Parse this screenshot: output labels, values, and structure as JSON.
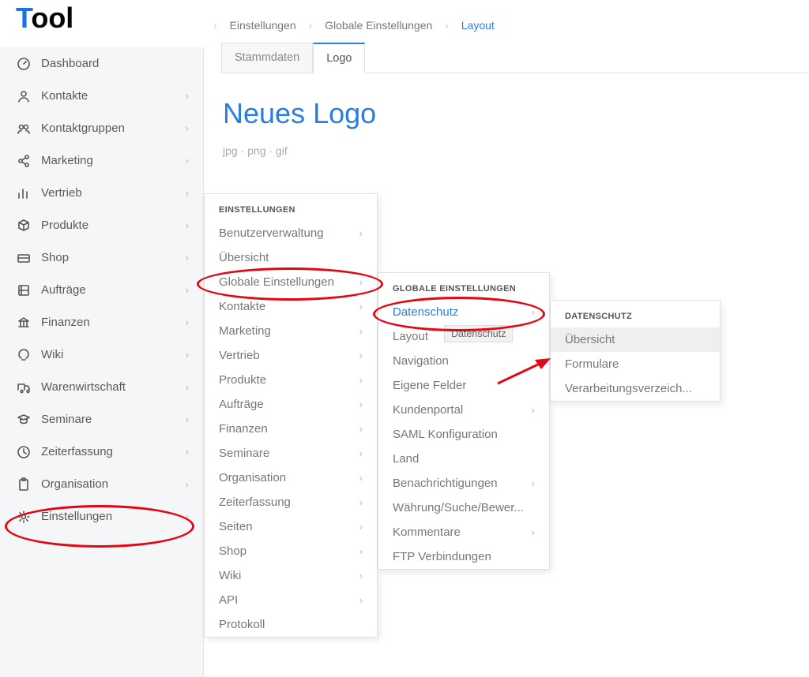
{
  "logo": {
    "t": "T",
    "rest": "ool"
  },
  "sidebar": {
    "items": [
      {
        "label": "Dashboard",
        "chev": false,
        "icon": "gauge"
      },
      {
        "label": "Kontakte",
        "chev": true,
        "icon": "person"
      },
      {
        "label": "Kontaktgruppen",
        "chev": true,
        "icon": "group"
      },
      {
        "label": "Marketing",
        "chev": true,
        "icon": "share"
      },
      {
        "label": "Vertrieb",
        "chev": true,
        "icon": "bars"
      },
      {
        "label": "Produkte",
        "chev": true,
        "icon": "box"
      },
      {
        "label": "Shop",
        "chev": true,
        "icon": "card"
      },
      {
        "label": "Aufträge",
        "chev": true,
        "icon": "order"
      },
      {
        "label": "Finanzen",
        "chev": true,
        "icon": "bank"
      },
      {
        "label": "Wiki",
        "chev": true,
        "icon": "bulb"
      },
      {
        "label": "Warenwirtschaft",
        "chev": true,
        "icon": "truck"
      },
      {
        "label": "Seminare",
        "chev": true,
        "icon": "grad"
      },
      {
        "label": "Zeiterfassung",
        "chev": true,
        "icon": "clock"
      },
      {
        "label": "Organisation",
        "chev": true,
        "icon": "clip"
      },
      {
        "label": "Einstellungen",
        "chev": true,
        "icon": "gear"
      }
    ]
  },
  "breadcrumb": {
    "a": "Einstellungen",
    "b": "Globale Einstellungen",
    "c": "Layout"
  },
  "tabs": {
    "a": "Stammdaten",
    "b": "Logo"
  },
  "page": {
    "title": "Neues Logo",
    "hint": "jpg · png · gif"
  },
  "flyout1": {
    "head": "EINSTELLUNGEN",
    "items": [
      {
        "label": "Benutzerverwaltung",
        "chev": true
      },
      {
        "label": "Übersicht",
        "chev": false
      },
      {
        "label": "Globale Einstellungen",
        "chev": true
      },
      {
        "label": "Kontakte",
        "chev": true
      },
      {
        "label": "Marketing",
        "chev": true
      },
      {
        "label": "Vertrieb",
        "chev": true
      },
      {
        "label": "Produkte",
        "chev": true
      },
      {
        "label": "Aufträge",
        "chev": true
      },
      {
        "label": "Finanzen",
        "chev": true
      },
      {
        "label": "Seminare",
        "chev": true
      },
      {
        "label": "Organisation",
        "chev": true
      },
      {
        "label": "Zeiterfassung",
        "chev": true
      },
      {
        "label": "Seiten",
        "chev": true
      },
      {
        "label": "Shop",
        "chev": true
      },
      {
        "label": "Wiki",
        "chev": true
      },
      {
        "label": "API",
        "chev": true
      },
      {
        "label": "Protokoll",
        "chev": false
      }
    ]
  },
  "flyout2": {
    "head": "GLOBALE EINSTELLUNGEN",
    "items": [
      {
        "label": "Datenschutz",
        "chev": true,
        "highlight": true
      },
      {
        "label": "Layout",
        "chev": false
      },
      {
        "label": "Navigation",
        "chev": false
      },
      {
        "label": "Eigene Felder",
        "chev": false
      },
      {
        "label": "Kundenportal",
        "chev": true
      },
      {
        "label": "SAML Konfiguration",
        "chev": false
      },
      {
        "label": "Land",
        "chev": false
      },
      {
        "label": "Benachrichtigungen",
        "chev": true
      },
      {
        "label": "Währung/Suche/Bewer...",
        "chev": false
      },
      {
        "label": "Kommentare",
        "chev": true
      },
      {
        "label": "FTP Verbindungen",
        "chev": false
      }
    ]
  },
  "flyout3": {
    "head": "DATENSCHUTZ",
    "items": [
      {
        "label": "Übersicht",
        "hover": true
      },
      {
        "label": "Formulare"
      },
      {
        "label": "Verarbeitungsverzeich..."
      }
    ]
  },
  "tooltip": "Datenschutz"
}
